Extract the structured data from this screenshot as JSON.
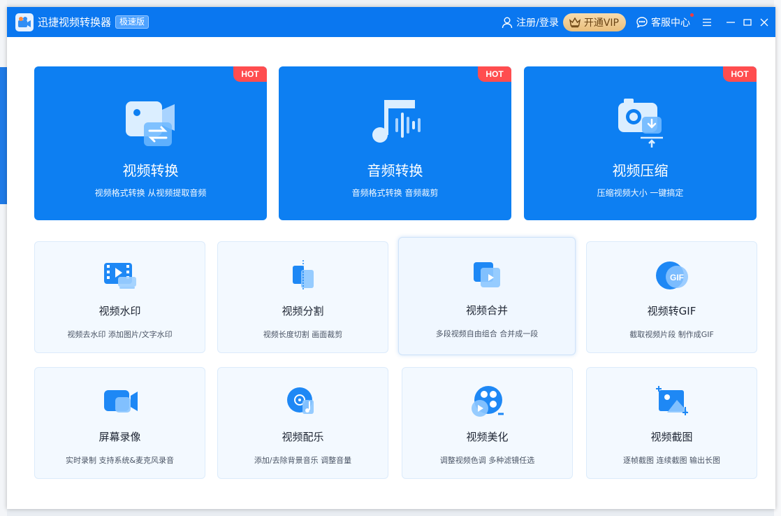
{
  "app": {
    "name": "迅捷视频转换器",
    "edition": "极速版"
  },
  "header": {
    "login_label": "注册/登录",
    "vip_label": "开通VIP",
    "service_label": "客服中心"
  },
  "featured": [
    {
      "title": "视频转换",
      "subtitle": "视频格式转换 从视频提取音频",
      "badge": "HOT"
    },
    {
      "title": "音频转换",
      "subtitle": "音频格式转换 音频裁剪",
      "badge": "HOT"
    },
    {
      "title": "视频压缩",
      "subtitle": "压缩视频大小 一键搞定",
      "badge": "HOT"
    }
  ],
  "tools": [
    {
      "title": "视频水印",
      "subtitle": "视频去水印 添加图片/文字水印",
      "icon": "watermark-icon"
    },
    {
      "title": "视频分割",
      "subtitle": "视频长度切割 画面裁剪",
      "icon": "split-icon"
    },
    {
      "title": "视频合并",
      "subtitle": "多段视频自由组合 合并成一段",
      "icon": "merge-icon"
    },
    {
      "title": "视频转GIF",
      "subtitle": "截取视频片段 制作成GIF",
      "icon": "gif-icon",
      "icon_text": "GIF"
    },
    {
      "title": "屏幕录像",
      "subtitle": "实时录制 支持系统&麦克风录音",
      "icon": "screen-record-icon"
    },
    {
      "title": "视频配乐",
      "subtitle": "添加/去除背景音乐 调整音量",
      "icon": "music-icon"
    },
    {
      "title": "视频美化",
      "subtitle": "调整视频色调 多种滤镜任选",
      "icon": "beautify-icon"
    },
    {
      "title": "视频截图",
      "subtitle": "逐帧截图 连续截图 输出长图",
      "icon": "screenshot-icon"
    }
  ],
  "colors": {
    "titlebar": "#0a77f0",
    "card_blue": "#0d7ff2",
    "hot": "#ff4d4f",
    "tool_bg": "#f3f9ff"
  }
}
